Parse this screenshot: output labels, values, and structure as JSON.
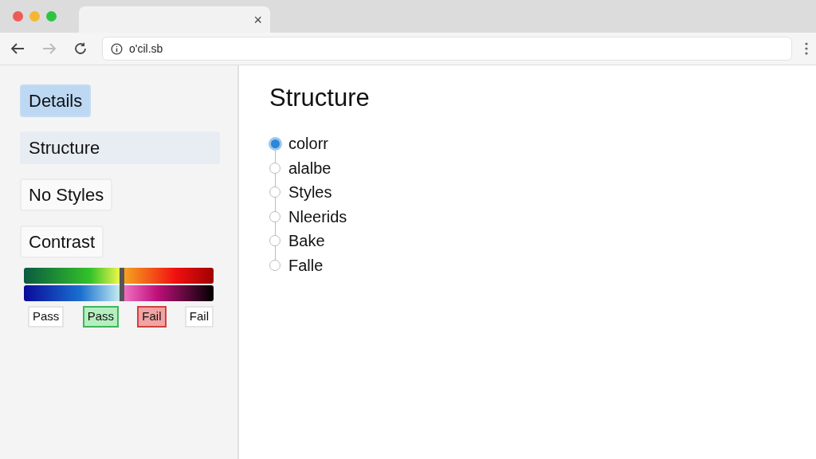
{
  "browser": {
    "tab_close": "×",
    "address": "o'cil.sb"
  },
  "sidebar": {
    "items": [
      {
        "label": "Details",
        "selected": true,
        "highlighted": false
      },
      {
        "label": "Structure",
        "selected": false,
        "highlighted": true
      },
      {
        "label": "No Styles",
        "selected": false,
        "highlighted": false
      },
      {
        "label": "Contrast",
        "selected": false,
        "highlighted": false
      }
    ],
    "contrast_meter": {
      "level": 0.51
    },
    "results": [
      {
        "label": "Pass",
        "kind": "plain"
      },
      {
        "label": "Pass",
        "kind": "pass"
      },
      {
        "label": "Fail",
        "kind": "fail"
      },
      {
        "label": "Fail",
        "kind": "plain"
      }
    ]
  },
  "main": {
    "heading": "Structure",
    "tree": [
      {
        "label": "colorr",
        "selected": true
      },
      {
        "label": "alalbe",
        "selected": false
      },
      {
        "label": "Styles",
        "selected": false
      },
      {
        "label": "Nleerids",
        "selected": false
      },
      {
        "label": "Bake",
        "selected": false
      },
      {
        "label": "Falle",
        "selected": false
      }
    ]
  }
}
